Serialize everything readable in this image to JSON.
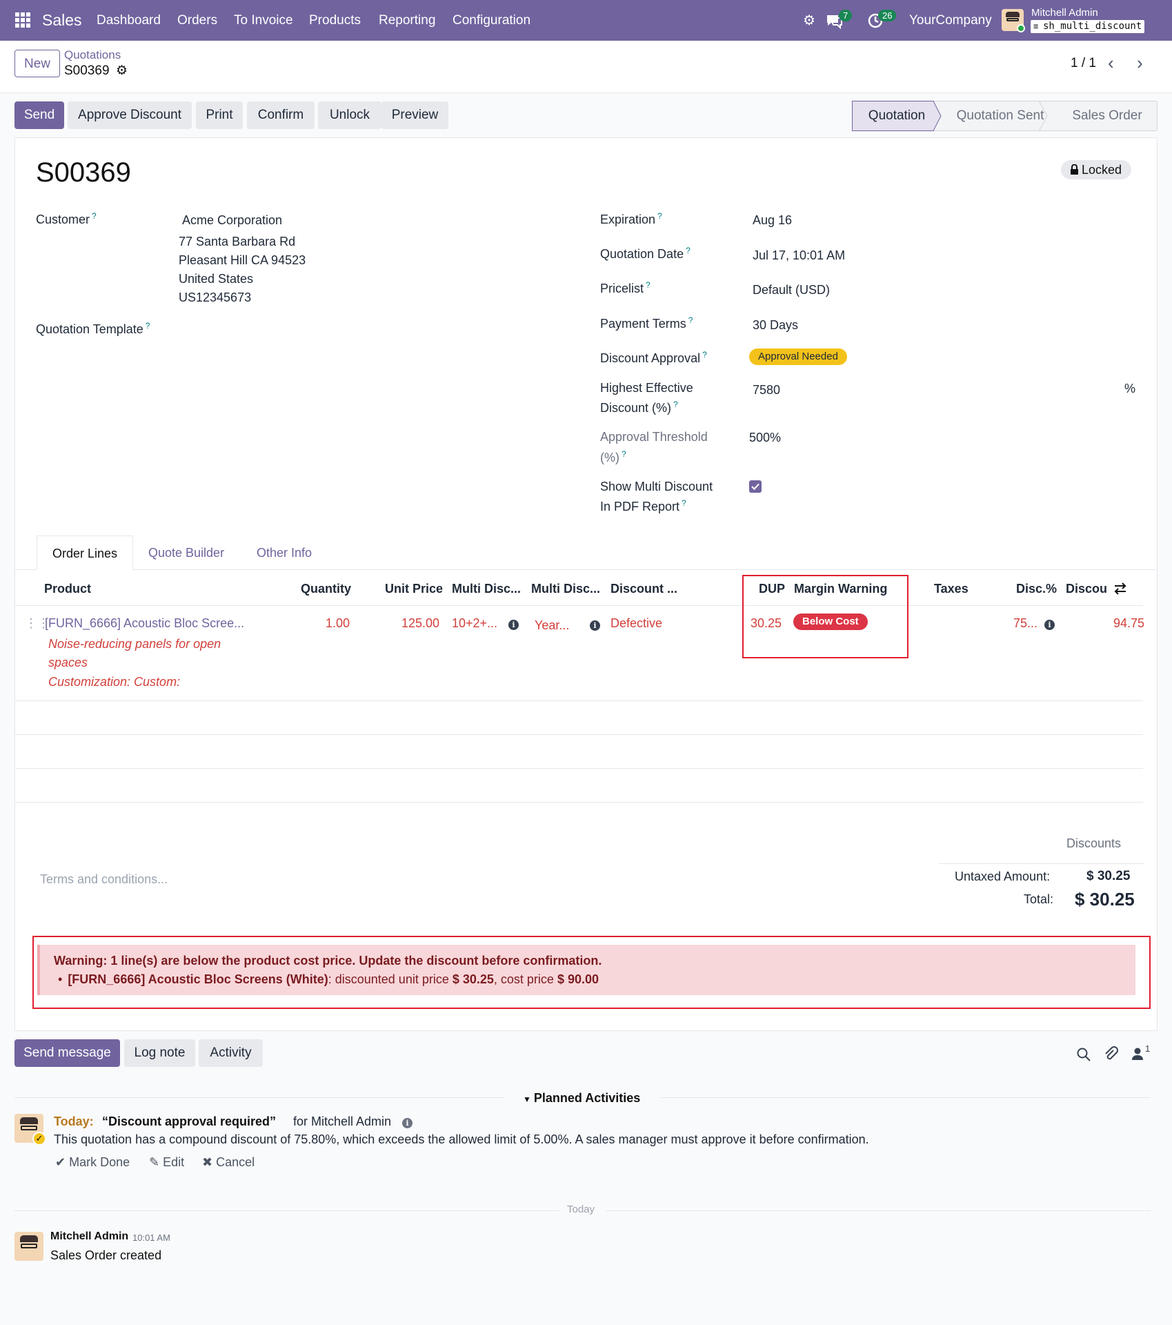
{
  "navbar": {
    "app_name": "Sales",
    "menu": [
      "Dashboard",
      "Orders",
      "To Invoice",
      "Products",
      "Reporting",
      "Configuration"
    ],
    "messages_count": "7",
    "activities_count": "26",
    "company": "YourCompany",
    "user_name": "Mitchell Admin",
    "db_name": "sh_multi_discount"
  },
  "control_panel": {
    "new_label": "New",
    "breadcrumb_parent": "Quotations",
    "breadcrumb_current": "S00369",
    "pager": "1 / 1"
  },
  "actions": {
    "send": "Send",
    "approve_discount": "Approve Discount",
    "print": "Print",
    "confirm": "Confirm",
    "unlock": "Unlock",
    "preview": "Preview"
  },
  "statusbar": [
    "Quotation",
    "Quotation Sent",
    "Sales Order"
  ],
  "form": {
    "title": "S00369",
    "locked": "Locked",
    "customer_label": "Customer",
    "customer_name": "Acme Corporation",
    "customer_address": [
      "77 Santa Barbara Rd",
      "Pleasant Hill CA 94523",
      "United States",
      "US12345673"
    ],
    "template_label": "Quotation Template",
    "expiration_label": "Expiration",
    "expiration": "Aug 16",
    "quotation_date_label": "Quotation Date",
    "quotation_date": "Jul 17, 10:01 AM",
    "pricelist_label": "Pricelist",
    "pricelist": "Default (USD)",
    "payment_terms_label": "Payment Terms",
    "payment_terms": "30 Days",
    "discount_approval_label": "Discount Approval",
    "discount_approval": "Approval Needed",
    "highest_discount_label_1": "Highest Effective",
    "highest_discount_label_2": "Discount (%)",
    "highest_discount": "7580",
    "percent_sign": "%",
    "threshold_label_1": "Approval Threshold",
    "threshold_label_2": "(%)",
    "threshold": "500%",
    "show_multi_label_1": "Show Multi Discount",
    "show_multi_label_2": "In PDF Report",
    "show_multi_checked": true
  },
  "tabs": [
    "Order Lines",
    "Quote Builder",
    "Other Info"
  ],
  "table": {
    "headers": [
      "Product",
      "Quantity",
      "Unit Price",
      "Multi Disc...",
      "Multi Disc...",
      "Discount ...",
      "DUP",
      "Margin Warning",
      "Taxes",
      "Disc.%",
      "Discou"
    ],
    "row": {
      "product": "[FURN_6666] Acoustic Bloc Scree...",
      "description": [
        "Noise-reducing panels for open",
        "spaces",
        "Customization: Custom:"
      ],
      "quantity": "1.00",
      "unit_price": "125.00",
      "multi_disc_1": "10+2+...",
      "multi_disc_2": "Year...",
      "discount_reason": "Defective",
      "dup": "30.25",
      "margin_warning": "Below Cost",
      "taxes": "",
      "disc_pct": "75...",
      "discount": "94.75"
    }
  },
  "footer": {
    "terms_placeholder": "Terms and conditions...",
    "discounts_label": "Discounts",
    "untaxed_label": "Untaxed Amount:",
    "untaxed_value": "$ 30.25",
    "total_label": "Total:",
    "total_value": "$ 30.25"
  },
  "warning": {
    "title": "Warning: 1 line(s) are below the product cost price. Update the discount before confirmation.",
    "item_product": "[FURN_6666] Acoustic Bloc Screens (White)",
    "item_text_1": ": discounted unit price ",
    "item_price": "$ 30.25",
    "item_text_2": ", cost price ",
    "item_cost": "$ 90.00"
  },
  "chatter": {
    "send_message": "Send message",
    "log_note": "Log note",
    "activity": "Activity",
    "followers_count": "1",
    "planned_activities": "Planned Activities",
    "activity_when": "Today:",
    "activity_title": "“Discount approval required”",
    "activity_for": "for Mitchell Admin",
    "activity_note": "This quotation has a compound discount of 75.80%, which exceeds the allowed limit of 5.00%. A sales manager must approve it before confirmation.",
    "mark_done": "Mark Done",
    "edit": "Edit",
    "cancel": "Cancel",
    "today_separator": "Today",
    "message_author": "Mitchell Admin",
    "message_time": "10:01 AM",
    "message_body": "Sales Order created"
  },
  "colors": {
    "brand": "#71639e",
    "danger": "#d23f3a",
    "warning_badge": "#f3c21a",
    "alert_bg": "#f8d7da",
    "highlight_border": "#e11d2e"
  }
}
